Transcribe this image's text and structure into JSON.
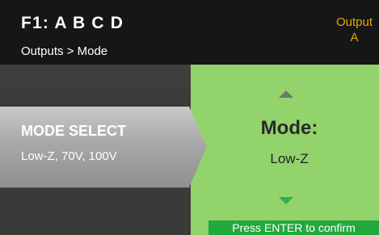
{
  "header": {
    "device_title": "F1: A B C D",
    "breadcrumb": "Outputs > Mode",
    "output_label": "Output",
    "output_value": "A"
  },
  "menu": {
    "selected_label": "MODE SELECT",
    "selected_options": "Low-Z, 70V, 100V"
  },
  "editor": {
    "title": "Mode:",
    "value": "Low-Z",
    "confirm_hint": "Press ENTER to confirm",
    "up_arrow_icon": "triangle-up",
    "down_arrow_icon": "triangle-down"
  },
  "colors": {
    "header_bg": "#161616",
    "accent_orange": "#e6a700",
    "panel_green": "#93d36c",
    "confirm_green": "#22a93c",
    "menu_gray": "#3b3b3b"
  }
}
